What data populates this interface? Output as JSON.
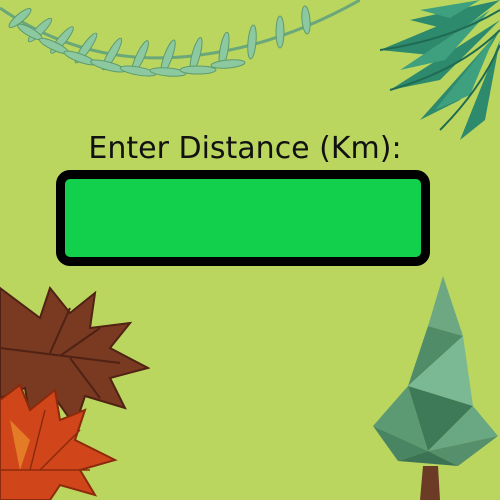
{
  "form": {
    "distance_label": "Enter Distance (Km):",
    "distance_value": "",
    "distance_placeholder": ""
  },
  "decor": {
    "fern": "fern-leaf-icon",
    "palm": "palm-leaf-icon",
    "maple_brown": "maple-leaf-brown-icon",
    "maple_orange": "maple-leaf-orange-icon",
    "tree": "lowpoly-tree-icon"
  },
  "colors": {
    "background": "#bbd65f",
    "input_fill": "#12d04c",
    "input_border": "#000000"
  }
}
